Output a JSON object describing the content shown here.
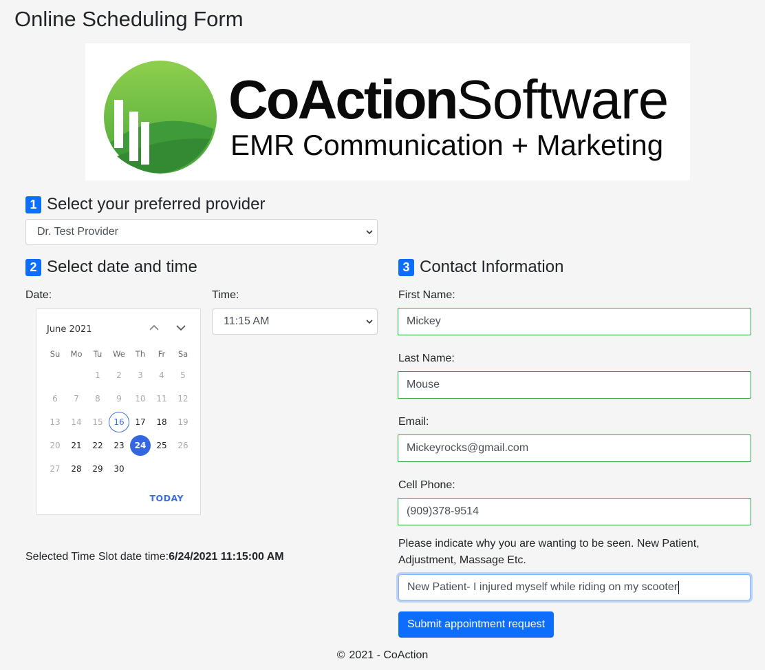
{
  "page": {
    "title": "Online Scheduling Form"
  },
  "logo": {
    "word_bold": "CoAction",
    "word_light": "Software",
    "tagline": "EMR Communication + Marketing"
  },
  "step1": {
    "number": "1",
    "title": "Select your preferred provider",
    "provider_value": "Dr. Test Provider"
  },
  "step2": {
    "number": "2",
    "title": "Select date and time",
    "date_label": "Date:",
    "time_label": "Time:",
    "time_value": "11:15 AM"
  },
  "calendar": {
    "month_label": "June 2021",
    "weekdays": [
      "Su",
      "Mo",
      "Tu",
      "We",
      "Th",
      "Fr",
      "Sa"
    ],
    "today_label": "TODAY",
    "days": [
      {
        "d": "1",
        "state": "disabled"
      },
      {
        "d": "2",
        "state": "disabled"
      },
      {
        "d": "3",
        "state": "disabled"
      },
      {
        "d": "4",
        "state": "disabled"
      },
      {
        "d": "5",
        "state": "disabled"
      },
      {
        "d": "6",
        "state": "disabled"
      },
      {
        "d": "7",
        "state": "disabled"
      },
      {
        "d": "8",
        "state": "disabled"
      },
      {
        "d": "9",
        "state": "disabled"
      },
      {
        "d": "10",
        "state": "disabled"
      },
      {
        "d": "11",
        "state": "disabled"
      },
      {
        "d": "12",
        "state": "disabled"
      },
      {
        "d": "13",
        "state": "disabled"
      },
      {
        "d": "14",
        "state": "disabled"
      },
      {
        "d": "15",
        "state": "disabled"
      },
      {
        "d": "16",
        "state": "today"
      },
      {
        "d": "17",
        "state": "enabled"
      },
      {
        "d": "18",
        "state": "enabled"
      },
      {
        "d": "19",
        "state": "disabled"
      },
      {
        "d": "20",
        "state": "disabled"
      },
      {
        "d": "21",
        "state": "enabled"
      },
      {
        "d": "22",
        "state": "enabled"
      },
      {
        "d": "23",
        "state": "enabled"
      },
      {
        "d": "24",
        "state": "selected"
      },
      {
        "d": "25",
        "state": "enabled"
      },
      {
        "d": "26",
        "state": "disabled"
      },
      {
        "d": "27",
        "state": "disabled"
      },
      {
        "d": "28",
        "state": "enabled"
      },
      {
        "d": "29",
        "state": "enabled"
      },
      {
        "d": "30",
        "state": "enabled"
      }
    ],
    "first_weekday_index": 2
  },
  "slot": {
    "label": "Selected Time Slot date time:",
    "value": "6/24/2021 11:15:00 AM"
  },
  "step3": {
    "number": "3",
    "title": "Contact Information",
    "first_name_label": "First Name:",
    "first_name_value": "Mickey",
    "last_name_label": "Last Name:",
    "last_name_value": "Mouse",
    "email_label": "Email:",
    "email_value": "Mickeyrocks@gmail.com",
    "phone_label": "Cell Phone:",
    "phone_value": "(909)378-9514",
    "reason_label": "Please indicate why you are wanting to be seen. New Patient, Adjustment, Massage Etc.",
    "reason_value": "New Patient- I injured myself while riding on my scooter"
  },
  "submit": {
    "label": "Submit appointment request"
  },
  "footer": {
    "copyright": "©",
    "text": "2021 - CoAction"
  },
  "icons": {
    "calendar_prev": "chevron-up-icon",
    "calendar_next": "chevron-down-icon",
    "select": "chevron-down-icon"
  },
  "colors": {
    "primary": "#0d6efd",
    "valid_border": "#28a745",
    "calendar_accent": "#3366e0"
  }
}
